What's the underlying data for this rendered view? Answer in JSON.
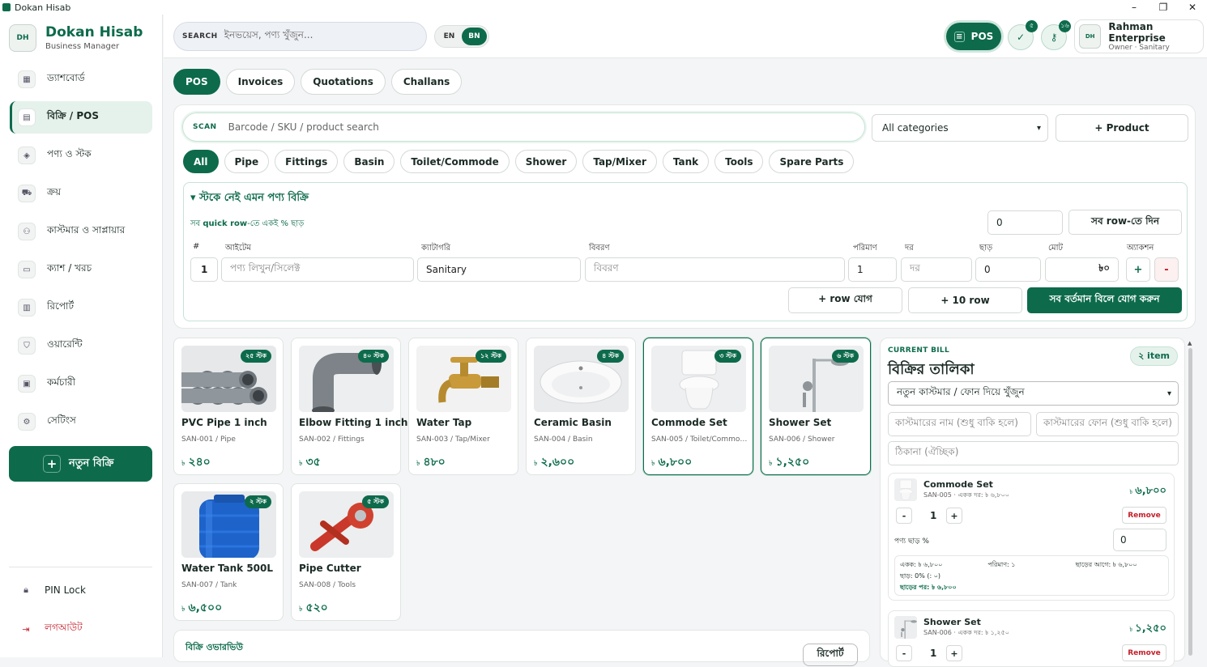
{
  "window": {
    "title": "Dokan Hisab",
    "controls": [
      "–",
      "❐",
      "✕"
    ]
  },
  "brand": {
    "logo_text": "DH",
    "name": "Dokan Hisab",
    "subtitle": "Business Manager"
  },
  "sidebar": {
    "items": [
      {
        "label": "ড্যাশবোর্ড",
        "icon": "grid-icon",
        "glyph": "▦"
      },
      {
        "label": "বিক্রি / POS",
        "icon": "receipt-icon",
        "glyph": "▤",
        "active": true
      },
      {
        "label": "পণ্য ও স্টক",
        "icon": "box-icon",
        "glyph": "◈"
      },
      {
        "label": "ক্রয়",
        "icon": "truck-icon",
        "glyph": "⛟"
      },
      {
        "label": "কাস্টমার ও সাপ্লায়ার",
        "icon": "users-icon",
        "glyph": "⚇"
      },
      {
        "label": "ক্যাশ / খরচ",
        "icon": "wallet-icon",
        "glyph": "▭"
      },
      {
        "label": "রিপোর্ট",
        "icon": "chart-icon",
        "glyph": "▥"
      },
      {
        "label": "ওয়ারেন্টি",
        "icon": "shield-icon",
        "glyph": "⛉"
      },
      {
        "label": "কর্মচারী",
        "icon": "calendar-icon",
        "glyph": "▣"
      },
      {
        "label": "সেটিংস",
        "icon": "gear-icon",
        "glyph": "⚙"
      }
    ],
    "new_sale": "নতুন বিক্রি",
    "pin_lock": "PIN Lock",
    "logout": "লগআউট"
  },
  "topbar": {
    "search_label": "SEARCH",
    "search_placeholder": "ইনভয়েস, পণ্য খুঁজুন...",
    "lang_en": "EN",
    "lang_bn": "BN",
    "pos_label": "POS",
    "badge_check": "৫",
    "badge_key": "১৬",
    "profile_logo": "DH",
    "profile_name": "Rahman Enterprise",
    "profile_role": "Owner · Sanitary"
  },
  "tabs": [
    "POS",
    "Invoices",
    "Quotations",
    "Challans"
  ],
  "pos": {
    "scan_label": "SCAN",
    "scan_placeholder": "Barcode / SKU / product search",
    "category_select": "All categories",
    "add_product": "+ Product",
    "categories": [
      "All",
      "Pipe",
      "Fittings",
      "Basin",
      "Toilet/Commode",
      "Shower",
      "Tap/Mixer",
      "Tank",
      "Tools",
      "Spare Parts"
    ]
  },
  "quick_sale": {
    "title": "▾ স্টকে নেই এমন পণ্য বিক্রি",
    "subtitle_pre": "সব ",
    "subtitle_bold": "quick row",
    "subtitle_post": "-তে একই % ছাড়",
    "discount_value": "0",
    "apply_all": "সব row-তে দিন",
    "columns": {
      "num": "#",
      "item": "আইটেম",
      "category": "ক্যাটাগরি",
      "desc": "বিবরণ",
      "qty": "পরিমাণ",
      "rate": "দর",
      "discount": "ছাড়",
      "total": "মোট",
      "action": "অ্যাকশন"
    },
    "row": {
      "num": "1",
      "item_placeholder": "পণ্য লিখুন/সিলেক্ট",
      "category": "Sanitary",
      "desc_placeholder": "বিবরণ",
      "qty": "1",
      "rate_placeholder": "দর",
      "discount": "0",
      "total": "৳০",
      "plus": "+",
      "minus": "-"
    },
    "add_row": "+ row যোগ",
    "add_10": "+ 10 row",
    "add_to_bill": "সব বর্তমান বিলে যোগ করুন"
  },
  "products": [
    {
      "name": "PVC Pipe 1 inch",
      "sku": "SAN-001 / Pipe",
      "price": "২৪০",
      "stock": "২৫ স্টক",
      "kind": "pipe"
    },
    {
      "name": "Elbow Fitting 1 inch",
      "sku": "SAN-002 / Fittings",
      "price": "৩৫",
      "stock": "৪০ স্টক",
      "kind": "elbow"
    },
    {
      "name": "Water Tap",
      "sku": "SAN-003 / Tap/Mixer",
      "price": "৪৮০",
      "stock": "১২ স্টক",
      "kind": "tap"
    },
    {
      "name": "Ceramic Basin",
      "sku": "SAN-004 / Basin",
      "price": "২,৬০০",
      "stock": "৪ স্টক",
      "kind": "basin"
    },
    {
      "name": "Commode Set",
      "sku": "SAN-005 / Toilet/Commode",
      "price": "৬,৮০০",
      "stock": "৩ স্টক",
      "kind": "commode",
      "selected": true
    },
    {
      "name": "Shower Set",
      "sku": "SAN-006 / Shower",
      "price": "১,২৫০",
      "stock": "৬ স্টক",
      "kind": "shower",
      "selected": true
    },
    {
      "name": "Water Tank 500L",
      "sku": "SAN-007 / Tank",
      "price": "৬,৫০০",
      "stock": "২ স্টক",
      "kind": "tank"
    },
    {
      "name": "Pipe Cutter",
      "sku": "SAN-008 / Tools",
      "price": "৫২০",
      "stock": "৫ স্টক",
      "kind": "cutter"
    }
  ],
  "currency_symbol": "৳",
  "overview": {
    "title": "বিক্রি ওভারভিউ",
    "report_btn": "রিপোর্ট"
  },
  "bill": {
    "label": "CURRENT BILL",
    "title": "বিক্রির তালিকা",
    "count": "২ item",
    "customer_select": "নতুন কাস্টমার / ফোন দিয়ে খুঁজুন",
    "name_placeholder": "কাস্টমারের নাম (শুধু বাকি হলে)",
    "phone_placeholder": "কাস্টমারের ফোন (শুধু বাকি হলে)",
    "address_placeholder": "ঠিকানা (ঐচ্ছিক)",
    "items": [
      {
        "name": "Commode Set",
        "meta": "SAN-005 · একক দর: ৳ ৬,৮০০",
        "amount": "৬,৮০০",
        "qty": "1",
        "remove": "Remove",
        "disc_label": "পণ্য ছাড় %",
        "disc_value": "0",
        "unit": "একক: ৳ ৬,৮০০",
        "qty_text": "পরিমাণ: ১",
        "before": "ছাড়ের আগে: ৳ ৬,৮০০",
        "disc_text": "ছাড়: 0% (: ০)",
        "after": "ছাড়ের পর: ৳ ৬,৮০০"
      },
      {
        "name": "Shower Set",
        "meta": "SAN-006 · একক দর: ৳ ১,২৫০",
        "amount": "১,২৫০",
        "qty": "1",
        "remove": "Remove"
      }
    ],
    "qty_minus": "-",
    "qty_plus": "+"
  },
  "colors": {
    "primary": "#0d6b4c",
    "danger": "#c4202a"
  }
}
